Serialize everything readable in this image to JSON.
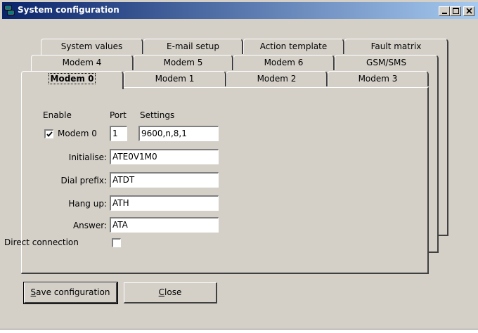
{
  "window": {
    "title": "System configuration"
  },
  "tabs": {
    "row_back": [
      "System values",
      "E-mail setup",
      "Action template",
      "Fault matrix"
    ],
    "row_middle": [
      "Modem 4",
      "Modem 5",
      "Modem 6",
      "GSM/SMS"
    ],
    "row_front": [
      "Modem 0",
      "Modem 1",
      "Modem 2",
      "Modem 3"
    ],
    "active": "Modem 0"
  },
  "form": {
    "col_enable": "Enable",
    "col_port": "Port",
    "col_settings": "Settings",
    "modem_label": "Modem 0",
    "modem_enabled": true,
    "port": "1",
    "settings": "9600,n,8,1",
    "initialise_label": "Initialise:",
    "initialise": "ATE0V1M0",
    "dial_prefix_label": "Dial prefix:",
    "dial_prefix": "ATDT",
    "hang_up_label": "Hang up:",
    "hang_up": "ATH",
    "answer_label": "Answer:",
    "answer": "ATA",
    "direct_label": "Direct connection",
    "direct_enabled": false
  },
  "buttons": {
    "save_mnemonic": "S",
    "save_rest": "ave configuration",
    "close_mnemonic": "C",
    "close_rest": "lose"
  },
  "icons": [
    "app-icon",
    "minimize-icon",
    "maximize-icon",
    "close-icon",
    "checkmark-icon"
  ]
}
